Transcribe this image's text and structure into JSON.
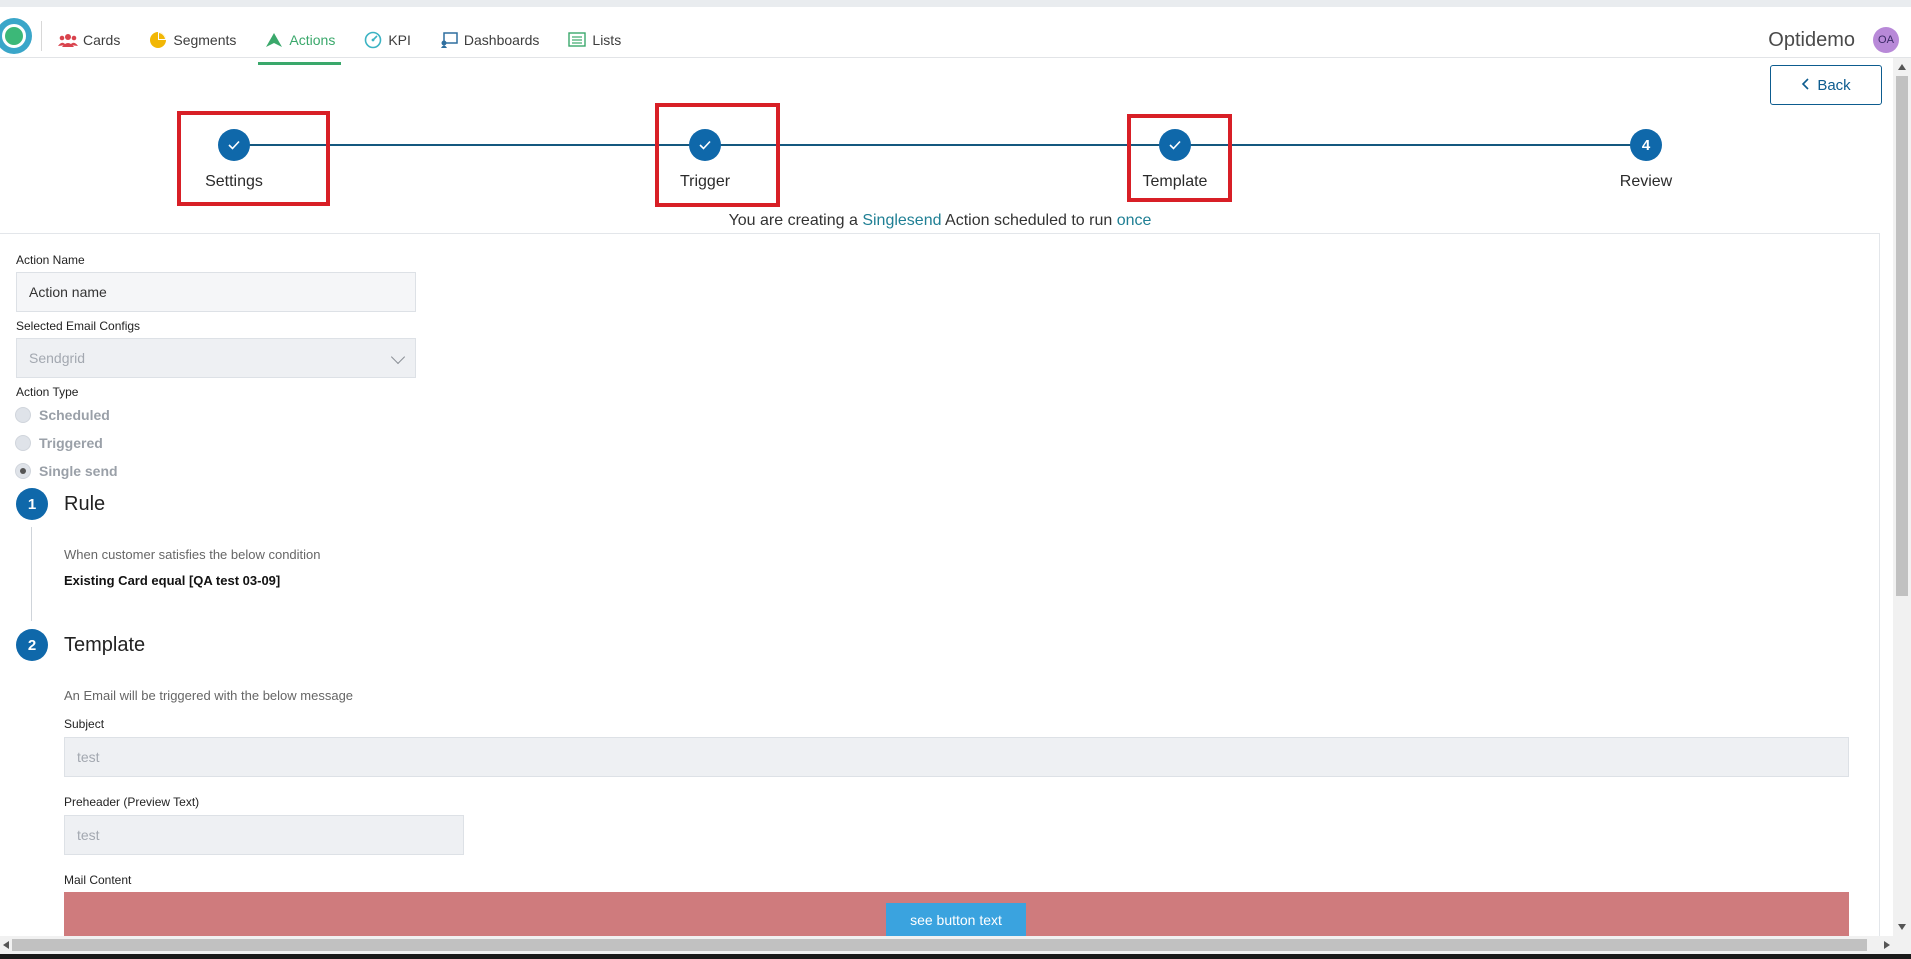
{
  "nav": {
    "items": [
      {
        "label": "Cards",
        "icon": "users-icon",
        "active": false
      },
      {
        "label": "Segments",
        "icon": "pie-chart-icon",
        "active": false
      },
      {
        "label": "Actions",
        "icon": "send-icon",
        "active": true
      },
      {
        "label": "KPI",
        "icon": "gauge-icon",
        "active": false
      },
      {
        "label": "Dashboards",
        "icon": "dashboard-icon",
        "active": false
      },
      {
        "label": "Lists",
        "icon": "list-icon",
        "active": false
      }
    ],
    "brand": "Optidemo",
    "avatar": "OA"
  },
  "back_label": "Back",
  "stepper": {
    "steps": [
      {
        "label": "Settings",
        "status": "done",
        "number": "1"
      },
      {
        "label": "Trigger",
        "status": "done",
        "number": "2"
      },
      {
        "label": "Template",
        "status": "done",
        "number": "3"
      },
      {
        "label": "Review",
        "status": "current",
        "number": "4"
      }
    ]
  },
  "summary": {
    "prefix": "You are creating a",
    "type": "Singlesend",
    "middle": "Action scheduled to run",
    "frequency": "once"
  },
  "form": {
    "action_name_label": "Action Name",
    "action_name_value": "Action name",
    "email_config_label": "Selected Email Configs",
    "email_config_value": "Sendgrid",
    "action_type_label": "Action Type",
    "action_types": [
      {
        "label": "Scheduled",
        "selected": false
      },
      {
        "label": "Triggered",
        "selected": false
      },
      {
        "label": "Single send",
        "selected": true
      }
    ]
  },
  "rule": {
    "number": "1",
    "title": "Rule",
    "description": "When customer satisfies the below condition",
    "condition": "Existing Card equal [QA test 03-09]"
  },
  "template": {
    "number": "2",
    "title": "Template",
    "description": "An Email will be triggered with the below message",
    "subject_label": "Subject",
    "subject_value": "test",
    "preheader_label": "Preheader (Preview Text)",
    "preheader_value": "test",
    "mail_content_label": "Mail Content",
    "mail_button_text": "see button text"
  },
  "colors": {
    "primary": "#0f68aa",
    "active_nav": "#3aa86b",
    "highlight": "#d81f26",
    "mail_bg": "#cf7b7d",
    "mail_button": "#3aa3df"
  }
}
